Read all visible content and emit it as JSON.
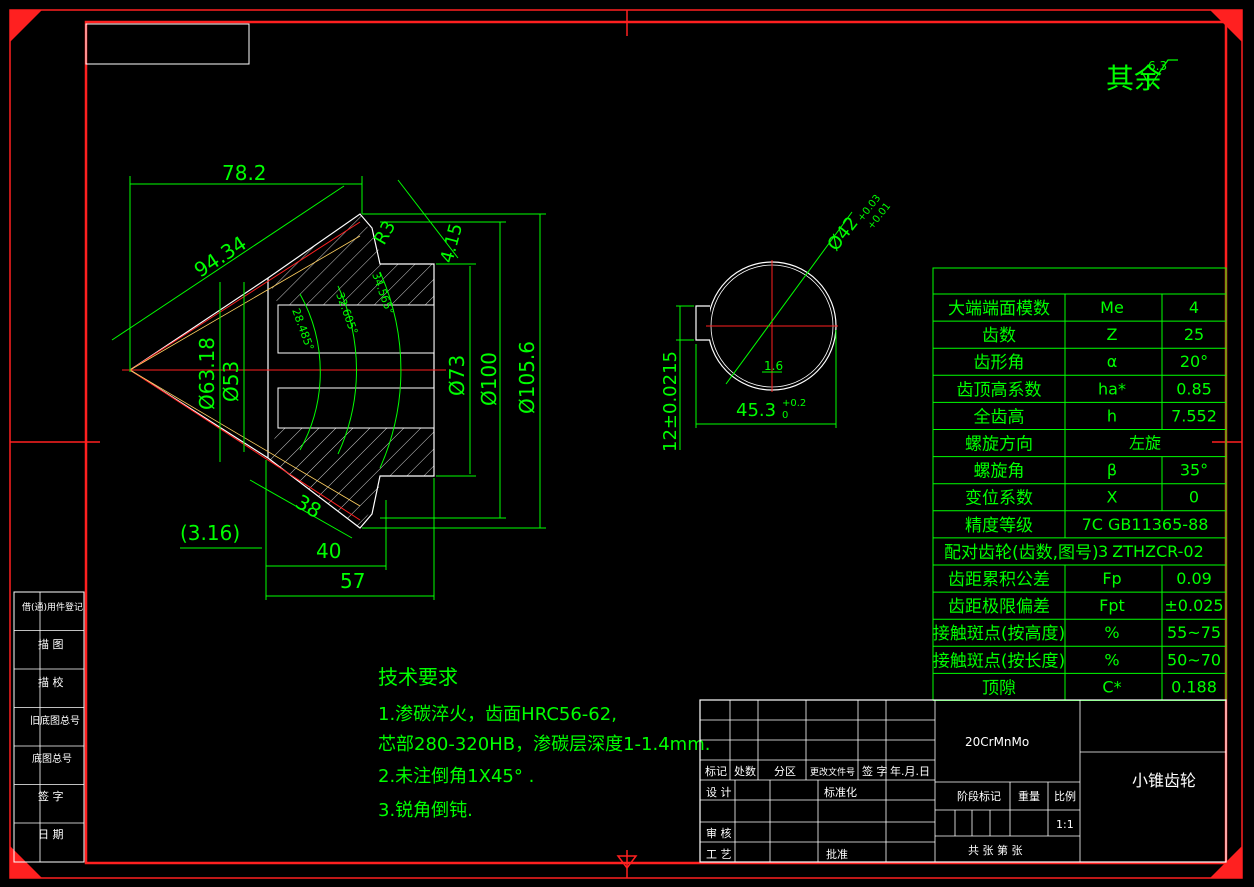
{
  "colors": {
    "background": "#000000",
    "frame": "#ff2020",
    "outline": "#ffffff",
    "dimension": "#00ff00",
    "table_text": "#00ff00",
    "centerline": "#ff2020"
  },
  "roughness_note": "其余",
  "roughness_value": "6.3",
  "gear_dims": {
    "d_78_2": "78.2",
    "d_94_34": "94.34",
    "d_r3": "R3",
    "d_4_15": "4.15",
    "d_63_18": "Ø63.18",
    "d_53": "Ø53",
    "d_73": "Ø73",
    "d_100": "Ø100",
    "d_105_6": "Ø105.6",
    "a_28": "28.485°",
    "a_32": "32.605°",
    "a_34": "34.565°",
    "d_38": "38",
    "d_40": "40",
    "d_57": "57",
    "d_3_16": "(3.16)"
  },
  "hub_dims": {
    "bore": "Ø42",
    "bore_tol_upper": "+0.03",
    "bore_tol_lower": "+0.01",
    "keyway_depth": "45.3",
    "keyway_tol_upper": "+0.2",
    "keyway_tol_lower": "0",
    "keyway_width": "12±0.0215",
    "fillet": "1.6"
  },
  "params": [
    {
      "name": "大端端面模数",
      "symbol": "Me",
      "value": "4"
    },
    {
      "name": "齿数",
      "symbol": "Z",
      "value": "25"
    },
    {
      "name": "齿形角",
      "symbol": "α",
      "value": "20°"
    },
    {
      "name": "齿顶高系数",
      "symbol": "ha*",
      "value": "0.85"
    },
    {
      "name": "全齿高",
      "symbol": "h",
      "value": "7.552"
    },
    {
      "name": "螺旋方向",
      "symbol": "",
      "value": "左旋"
    },
    {
      "name": "螺旋角",
      "symbol": "β",
      "value": "35°"
    },
    {
      "name": "变位系数",
      "symbol": "X",
      "value": "0"
    },
    {
      "name": "精度等级",
      "symbol": "",
      "value": "7C GB11365-88"
    },
    {
      "name": "配对齿轮(齿数,图号)",
      "symbol": "",
      "value": "ZTHZCR-02"
    },
    {
      "name": "齿距累积公差",
      "symbol": "Fp",
      "value": "0.09"
    },
    {
      "name": "齿距极限偏差",
      "symbol": "Fpt",
      "value": "±0.025"
    },
    {
      "name": "接触斑点(按高度)",
      "symbol": "%",
      "value": "55~75"
    },
    {
      "name": "接触斑点(按长度)",
      "symbol": "%",
      "value": "50~70"
    },
    {
      "name": "顶隙",
      "symbol": "C*",
      "value": "0.188"
    }
  ],
  "pair_count": "3",
  "tech_title": "技术要求",
  "tech_lines": [
    "1.渗碳淬火，齿面HRC56-62,",
    "芯部280-320HB，渗碳层深度1-1.4mm.",
    "2.未注倒角1X45° .",
    "3.锐角倒钝."
  ],
  "left_labels": [
    "借(通)用件登记",
    "描 图",
    "描 校",
    "旧底图总号",
    "底图总号",
    "签 字",
    "日 期"
  ],
  "title_block": {
    "h_mark": "标记",
    "h_count": "处数",
    "h_zone": "分区",
    "h_docno": "更改文件号",
    "h_sign": "签 字",
    "h_date": "年.月.日",
    "design": "设 计",
    "std": "标准化",
    "review": "审 核",
    "craft": "工 艺",
    "approve": "批准",
    "material": "20CrMnMo",
    "stage": "阶段标记",
    "weight": "重量",
    "scale": "比例",
    "scale_value": "1:1",
    "sheets": "共   张 第   张",
    "part_name": "小锥齿轮"
  }
}
